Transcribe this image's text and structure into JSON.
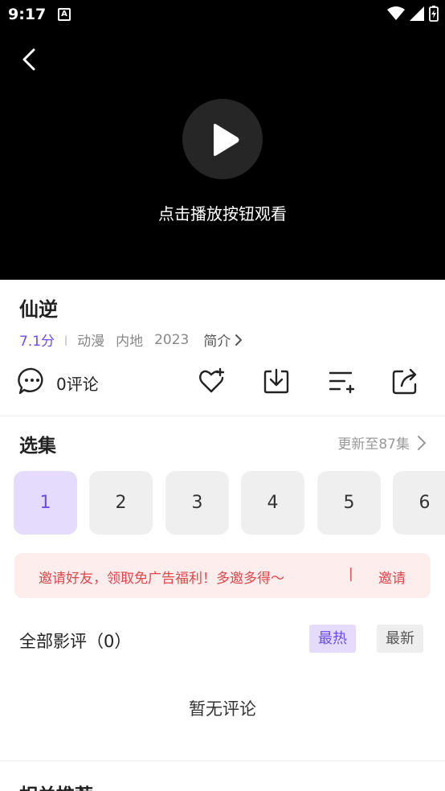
{
  "status": {
    "time": "9:17",
    "app_badge": "A"
  },
  "player": {
    "hint": "点击播放按钮观看"
  },
  "info": {
    "title": "仙逆",
    "score": "7.1分",
    "separator": "|",
    "genre": "动漫",
    "region": "内地",
    "year": "2023",
    "intro_label": "简介"
  },
  "actions": {
    "comment_label": "0评论"
  },
  "episodes": {
    "title": "选集",
    "more_label": "更新至87集",
    "items": [
      "1",
      "2",
      "3",
      "4",
      "5",
      "6"
    ],
    "selected": "1"
  },
  "invite": {
    "text": "邀请好友，领取免广告福利！多邀多得～",
    "divider": "|",
    "button": "邀请"
  },
  "reviews": {
    "title": "全部影评（0）",
    "sort_hot": "最热",
    "sort_new": "最新",
    "empty": "暂无评论"
  },
  "next_section": {
    "title": "相关推荐"
  },
  "colors": {
    "accent": "#6c4cf0",
    "accent_bg": "#e5dbfc",
    "invite_text": "#e0474c",
    "invite_bg": "#fdeded"
  }
}
